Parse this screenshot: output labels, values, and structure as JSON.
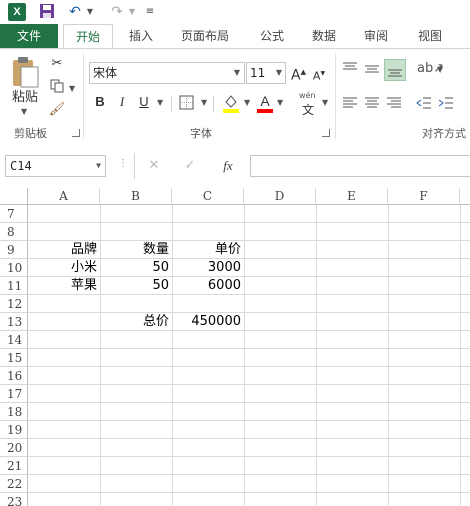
{
  "ribbon_tabs": [
    "文件",
    "开始",
    "插入",
    "页面布局",
    "公式",
    "数据",
    "审阅",
    "视图"
  ],
  "ribbon": {
    "paste_label": "粘贴",
    "clipboard_label": "剪贴板",
    "font_name": "宋体",
    "font_size": "11",
    "font_group_label": "字体",
    "align_group_label": "对齐方式",
    "bold": "B",
    "italic": "I",
    "underline": "U",
    "font_color_letter": "A",
    "phonetic_top": "wén",
    "phonetic_bottom": "文",
    "grow_font": "A",
    "shrink_font": "A"
  },
  "formula_bar": {
    "name_box": "C14",
    "cancel": "✕",
    "confirm": "✓",
    "fx": "fx",
    "formula": ""
  },
  "columns": [
    "A",
    "B",
    "C",
    "D",
    "E",
    "F"
  ],
  "rows": [
    "7",
    "8",
    "9",
    "10",
    "11",
    "12",
    "13",
    "14",
    "15",
    "16",
    "17",
    "18",
    "19",
    "20",
    "21",
    "22",
    "23"
  ],
  "cells": {
    "A9": "品牌",
    "B9": "数量",
    "C9": "单价",
    "A10": "小米",
    "B10": "50",
    "C10": "3000",
    "A11": "苹果",
    "B11": "50",
    "C11": "6000",
    "B13": "总价",
    "C13": "450000"
  },
  "colors": {
    "accent": "#217346",
    "excel_icon": "#1e7145",
    "highlight_yellow": "#ffff00",
    "font_red": "#ff0000",
    "active_align": "#c6e0cb"
  }
}
